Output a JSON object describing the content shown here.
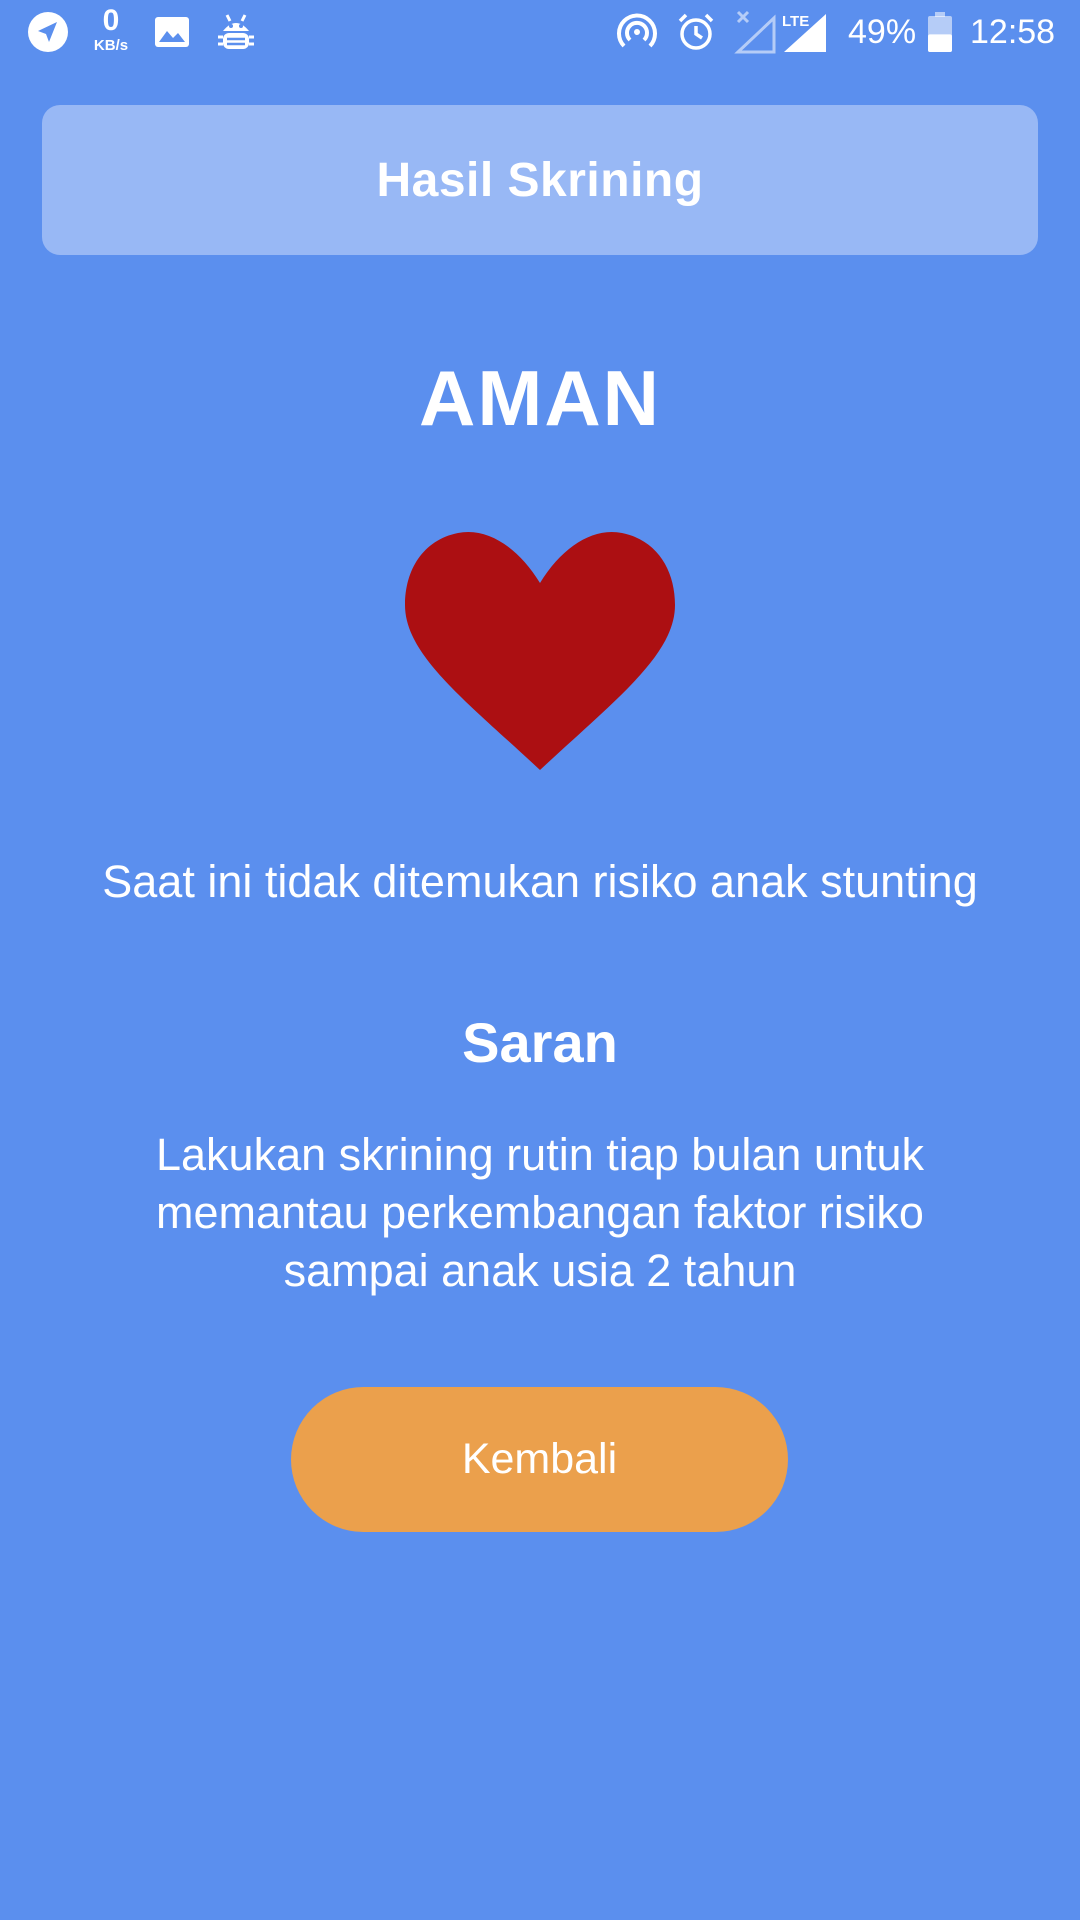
{
  "status_bar": {
    "left_icons": [
      "telegram-icon",
      "image-icon",
      "android-debug-icon"
    ],
    "net_speed_value": "0",
    "net_speed_unit": "KB/s",
    "right_icons": [
      "hotspot-icon",
      "alarm-icon",
      "lte-signal-icon"
    ],
    "lte_label": "LTE",
    "battery_percent": "49%",
    "battery_level": 0.49,
    "time": "12:58"
  },
  "header": {
    "title": "Hasil Skrining"
  },
  "result": {
    "status": "AMAN",
    "icon": "heart-icon",
    "message": "Saat ini tidak ditemukan risiko anak stunting"
  },
  "suggestion": {
    "title": "Saran",
    "text": "Lakukan skrining rutin tiap bulan untuk memantau perkembangan faktor risiko sampai anak usia 2 tahun"
  },
  "actions": {
    "back_label": "Kembali"
  },
  "colors": {
    "background": "#5b8fee",
    "header_card": "#98b8f5",
    "heart": "#ac0f12",
    "button": "#eba04c",
    "text": "#ffffff"
  }
}
